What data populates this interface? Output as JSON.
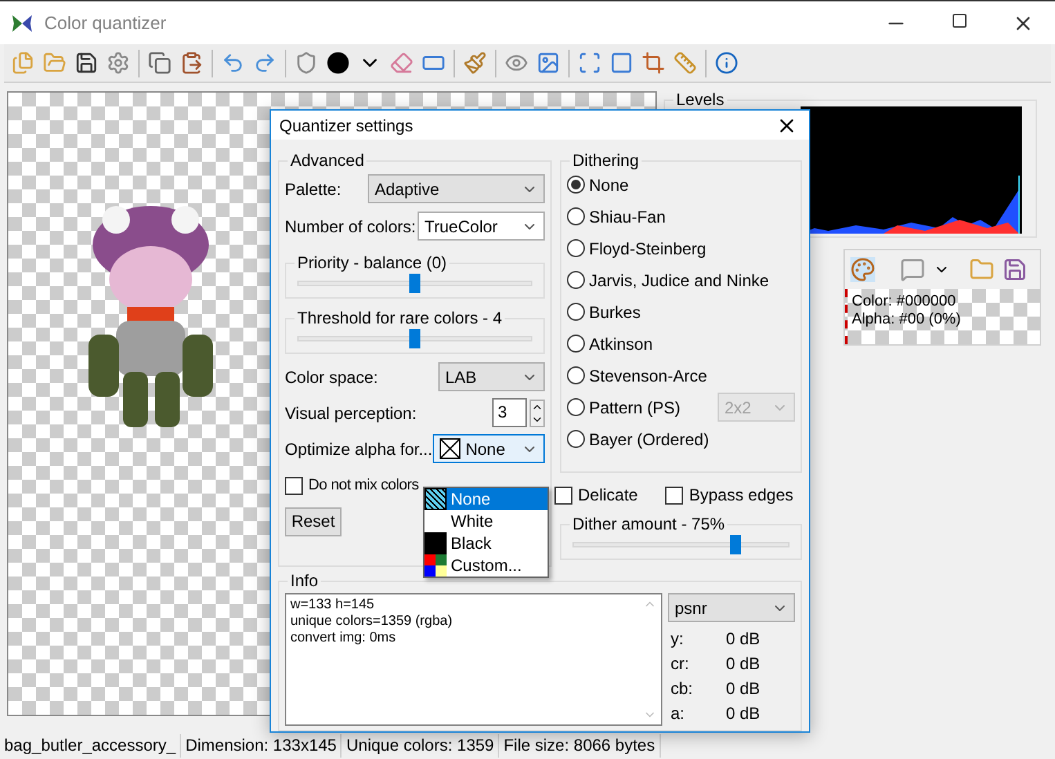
{
  "window": {
    "title": "Color quantizer"
  },
  "levels": {
    "title": "Levels"
  },
  "color_panel": {
    "color_text": "Color: #000000",
    "alpha_text": "Alpha: #00 (0%)"
  },
  "status_bar": [
    "bag_butler_accessory_",
    "Dimension: 133x145",
    "Unique colors: 1359",
    "File size: 8066 bytes"
  ],
  "dialog": {
    "title": "Quantizer settings",
    "advanced": {
      "title": "Advanced",
      "palette": {
        "label": "Palette:",
        "value": "Adaptive"
      },
      "number_of_colors": {
        "label": "Number of colors:",
        "value": "TrueColor"
      },
      "sliders": [
        {
          "label": "Priority - balance (0)",
          "level": 0.5
        },
        {
          "label": "Threshold for rare colors - 4",
          "level": 0.5
        }
      ],
      "color_space": {
        "label": "Color space:",
        "value": "LAB"
      },
      "visual_perception": {
        "label": "Visual perception:",
        "value": "3"
      },
      "optimize_alpha": {
        "label": "Optimize alpha for...",
        "value": "None",
        "kind": "none",
        "expanded": true,
        "options": [
          {
            "label": "None",
            "kind": "none",
            "selected": true
          },
          {
            "label": "White",
            "kind": "white",
            "selected": false
          },
          {
            "label": "Black",
            "kind": "black",
            "selected": false
          },
          {
            "label": "Custom...",
            "kind": "custom",
            "selected": false
          }
        ]
      },
      "do_not_mix": {
        "label": "Do not mix colors",
        "checked": false
      },
      "reset": "Reset"
    },
    "dithering": {
      "title": "Dithering",
      "options": [
        {
          "label": "None",
          "selected": true
        },
        {
          "label": "Shiau-Fan",
          "selected": false
        },
        {
          "label": "Floyd-Steinberg",
          "selected": false
        },
        {
          "label": "Jarvis, Judice and Ninke",
          "selected": false
        },
        {
          "label": "Burkes",
          "selected": false
        },
        {
          "label": "Atkinson",
          "selected": false
        },
        {
          "label": "Stevenson-Arce",
          "selected": false
        },
        {
          "label": "Pattern (PS)",
          "selected": false
        },
        {
          "label": "Bayer (Ordered)",
          "selected": false
        }
      ],
      "pattern_size": {
        "value": "2x2",
        "disabled": true
      },
      "delicate": {
        "label": "Delicate",
        "checked": false
      },
      "bypass_edges": {
        "label": "Bypass edges",
        "checked": false
      },
      "amount": {
        "label": "Dither amount - 75%",
        "level": 0.75
      }
    },
    "info": {
      "title": "Info",
      "lines": [
        "w=133 h=145",
        "unique colors=1359 (rgba)",
        "convert img: 0ms"
      ],
      "metric": "psnr",
      "metrics": [
        {
          "label": "y:",
          "value": "0 dB"
        },
        {
          "label": "cr:",
          "value": "0 dB"
        },
        {
          "label": "cb:",
          "value": "0 dB"
        },
        {
          "label": "a:",
          "value": "0 dB"
        }
      ]
    }
  }
}
